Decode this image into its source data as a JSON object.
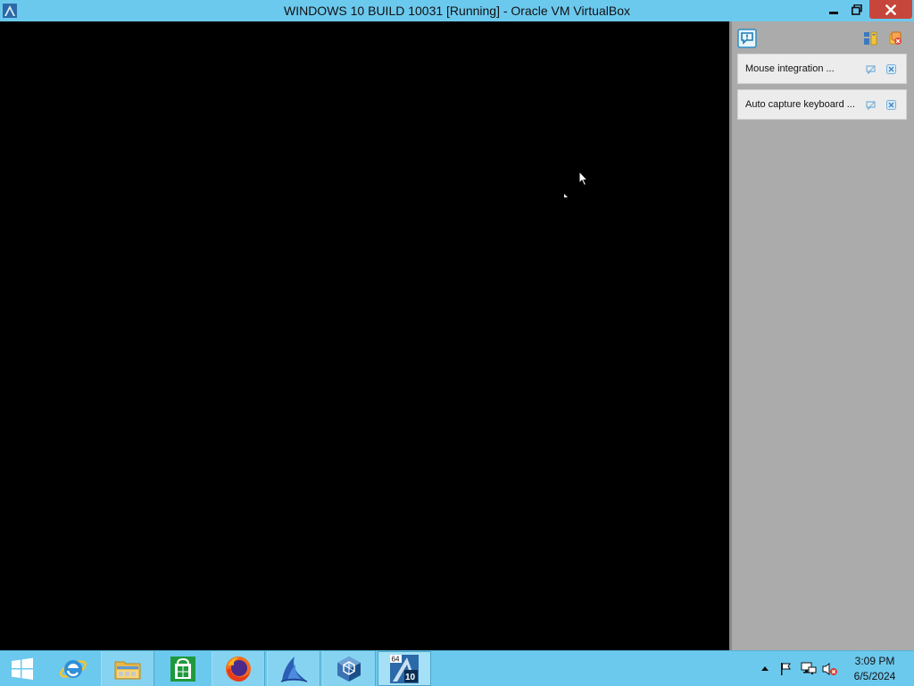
{
  "window": {
    "title": "WINDOWS 10 BUILD 10031 [Running] - Oracle VM VirtualBox",
    "controls": [
      "minimize-icon",
      "restore-icon",
      "close-icon"
    ]
  },
  "notification_center": {
    "header_icons": [
      "notification-center-icon",
      "dock-panel-icon",
      "dismiss-all-icon"
    ],
    "notifications": [
      {
        "text": "Mouse integration ...",
        "actions": [
          "help-icon",
          "close-icon"
        ]
      },
      {
        "text": "Auto capture keyboard ...",
        "actions": [
          "help-icon",
          "close-icon"
        ]
      }
    ]
  },
  "taskbar": {
    "items": [
      "start-button",
      "internet-explorer-icon",
      "file-explorer-icon",
      "store-icon",
      "firefox-icon",
      "shark-app-icon",
      "virtualbox-icon",
      "virtualbox-vm-icon"
    ],
    "vm_badge_bits": "64",
    "vm_badge_version": "10",
    "clock": {
      "time": "3:09 PM",
      "date": "6/5/2024"
    },
    "tray": [
      "show-hidden-icons",
      "action-center-flag-icon",
      "network-icon",
      "volume-muted-icon"
    ]
  },
  "colors": {
    "titlebar": "#6cc9ee",
    "close_button": "#c7463b",
    "taskbar": "#6cc9ee",
    "panel": "#ababab",
    "vm_screen": "#000000"
  }
}
